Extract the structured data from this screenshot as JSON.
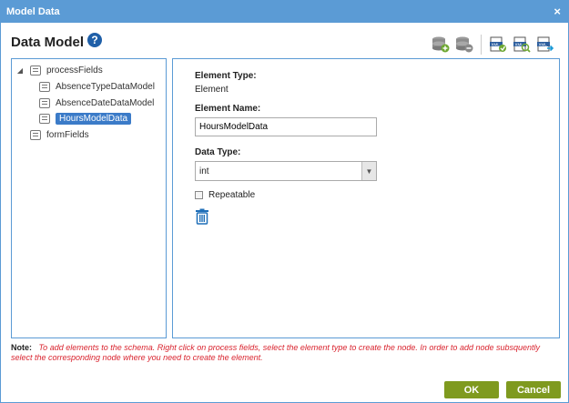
{
  "window": {
    "title": "Model Data",
    "close_glyph": "×"
  },
  "header": {
    "title": "Data Model",
    "help_glyph": "?"
  },
  "toolbar": {
    "icons": [
      "add-database-icon",
      "remove-database-icon",
      "xml-export-icon",
      "xml-search-icon",
      "xml-import-icon"
    ]
  },
  "tree": {
    "root": {
      "label": "processFields",
      "expanded": true
    },
    "children": [
      {
        "label": "AbsenceTypeDataModel"
      },
      {
        "label": "AbsenceDateDataModel"
      },
      {
        "label": "HoursModelData",
        "selected": true
      }
    ],
    "sibling": {
      "label": "formFields"
    }
  },
  "details": {
    "element_type_label": "Element Type:",
    "element_type_value": "Element",
    "element_name_label": "Element Name:",
    "element_name_value": "HoursModelData",
    "data_type_label": "Data Type:",
    "data_type_value": "int",
    "repeatable_label": "Repeatable",
    "repeatable_checked": false
  },
  "note": {
    "label": "Note:",
    "text": "To add elements to the schema. Right click on process fields, select the element type to create the node. In order to add node subsquently select the corresponding node where you need to create the element."
  },
  "buttons": {
    "ok": "OK",
    "cancel": "Cancel"
  },
  "colors": {
    "accent": "#5b9bd5",
    "selected": "#3b7bc8",
    "button": "#7f9a1f",
    "note_text": "#d9232e"
  }
}
